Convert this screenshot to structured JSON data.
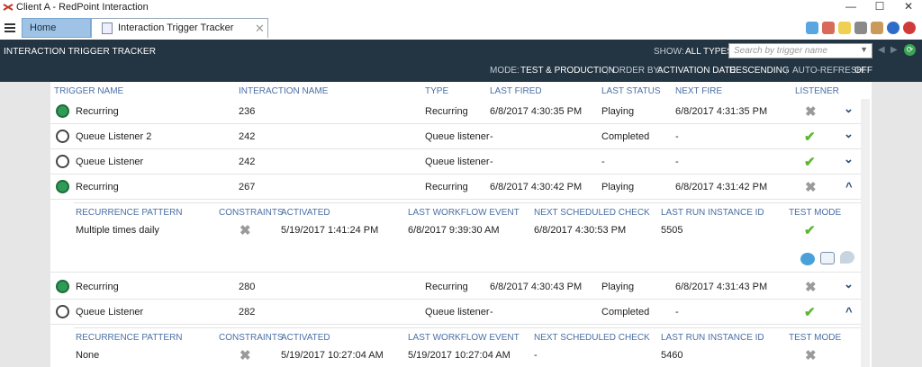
{
  "window": {
    "title": "Client A  -  RedPoint Interaction",
    "min": "—",
    "max": "☐",
    "close": "✕"
  },
  "tabs": {
    "home": "Home",
    "current": "Interaction Trigger Tracker",
    "close": "✕"
  },
  "header": {
    "title": "INTERACTION TRIGGER TRACKER",
    "show_label": "SHOW:",
    "show_value": "ALL TYPES",
    "search_placeholder": "Search by trigger name",
    "mode_label": "MODE:",
    "mode_value": "TEST & PRODUCTION",
    "order_label": "ORDER BY:",
    "order_field": "ACTIVATION DATE",
    "order_dir": "DESCENDING",
    "refresh_label": "AUTO-REFRESH:",
    "refresh_value": "OFF"
  },
  "columns": {
    "trigger_name": "TRIGGER NAME",
    "interaction_name": "INTERACTION NAME",
    "type": "TYPE",
    "last_fired": "LAST FIRED",
    "last_status": "LAST STATUS",
    "next_fire": "NEXT FIRE",
    "listener": "LISTENER"
  },
  "rows": [
    {
      "name": "Recurring",
      "interaction": "236",
      "type": "Recurring",
      "last_fired": "6/8/2017 4:30:35 PM",
      "status": "Playing",
      "next_fire": "6/8/2017 4:31:35 PM"
    },
    {
      "name": "Queue Listener 2",
      "interaction": "242",
      "type": "Queue listener",
      "last_fired": "-",
      "status": "Completed",
      "next_fire": "-"
    },
    {
      "name": "Queue Listener",
      "interaction": "242",
      "type": "Queue listener",
      "last_fired": "-",
      "status": "-",
      "next_fire": "-"
    },
    {
      "name": "Recurring",
      "interaction": "267",
      "type": "Recurring",
      "last_fired": "6/8/2017 4:30:42 PM",
      "status": "Playing",
      "next_fire": "6/8/2017 4:31:42 PM"
    },
    {
      "name": "Recurring",
      "interaction": "280",
      "type": "Recurring",
      "last_fired": "6/8/2017 4:30:43 PM",
      "status": "Playing",
      "next_fire": "6/8/2017 4:31:43 PM"
    },
    {
      "name": "Queue Listener",
      "interaction": "282",
      "type": "Queue listener",
      "last_fired": "-",
      "status": "Completed",
      "next_fire": "-"
    }
  ],
  "detail_columns": {
    "pattern": "RECURRENCE PATTERN",
    "constraints": "CONSTRAINTS",
    "activated": "ACTIVATED",
    "last_event": "LAST WORKFLOW EVENT",
    "next_check": "NEXT SCHEDULED CHECK",
    "instance": "LAST RUN INSTANCE ID",
    "test_mode": "TEST MODE"
  },
  "details": [
    {
      "pattern": "Multiple times daily",
      "activated": "5/19/2017 1:41:24 PM",
      "last_event": "6/8/2017 9:39:30 AM",
      "next_check": "6/8/2017 4:30:53 PM",
      "instance": "5505"
    },
    {
      "pattern": "None",
      "activated": "5/19/2017 10:27:04 AM",
      "last_event": "5/19/2017 10:27:04 AM",
      "next_check": "-",
      "instance": "5460"
    }
  ],
  "glyphs": {
    "x": "✖",
    "check": "✔",
    "chev_down": "⌄",
    "chev_up": "^"
  }
}
